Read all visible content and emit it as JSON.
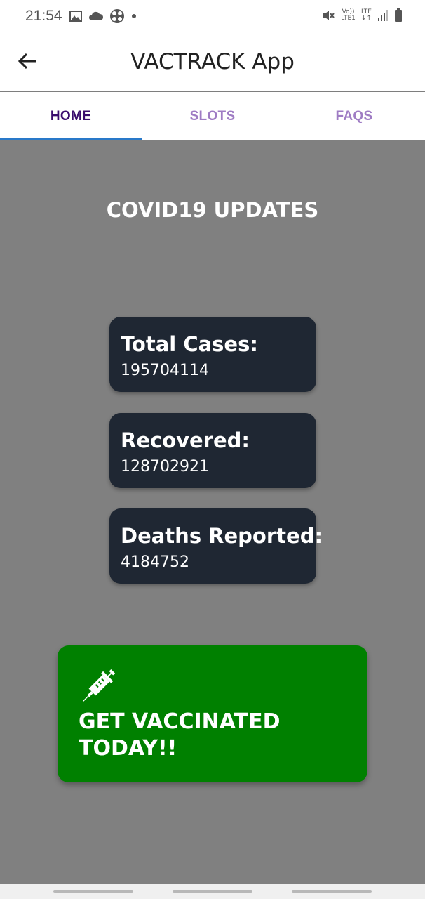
{
  "status_bar": {
    "time": "21:54",
    "left_icons": [
      "image-icon",
      "cloud-icon",
      "app-notification-icon",
      "dot-icon"
    ],
    "right_icons": [
      "mute-icon",
      "volte-icon",
      "lte-icon",
      "signal-icon",
      "battery-icon"
    ],
    "volte_top": "Vo))",
    "volte_bottom": "LTE1",
    "lte_label": "LTE"
  },
  "app_bar": {
    "title": "VACTRACK App",
    "back_icon": "arrow-left-icon"
  },
  "tabs": [
    {
      "label": "HOME",
      "active": true
    },
    {
      "label": "SLOTS",
      "active": false
    },
    {
      "label": "FAQS",
      "active": false
    }
  ],
  "main": {
    "section_title": "COVID19 UPDATES",
    "stats": [
      {
        "label": "Total Cases:",
        "value": "195704114"
      },
      {
        "label": "Recovered:",
        "value": "128702921"
      },
      {
        "label": "Deaths Reported:",
        "value": "4184752"
      }
    ],
    "cta": {
      "icon": "syringe-icon",
      "label": "GET VACCINATED TODAY!!"
    }
  },
  "colors": {
    "background": "#808080",
    "card": "#1f2733",
    "cta": "#008000",
    "tab_active": "#3a0d6e",
    "tab_inactive": "#9f7cc4",
    "tab_indicator": "#2979c9"
  }
}
